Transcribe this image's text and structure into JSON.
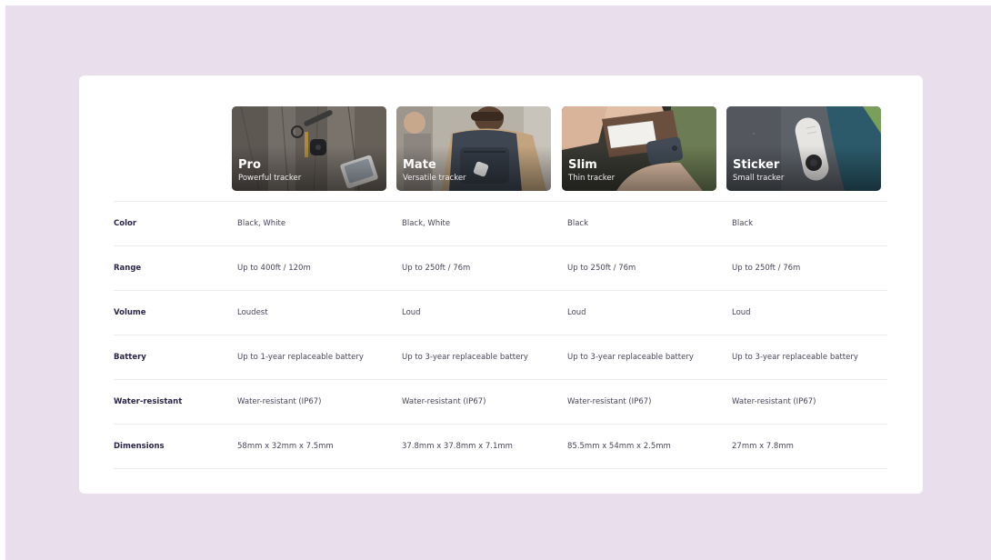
{
  "products": [
    {
      "name": "Pro",
      "tagline": "Powerful tracker",
      "image": "keys-on-wood-photo"
    },
    {
      "name": "Mate",
      "tagline": "Versatile tracker",
      "image": "backpack-photo"
    },
    {
      "name": "Slim",
      "tagline": "Thin tracker",
      "image": "wallet-photo"
    },
    {
      "name": "Sticker",
      "tagline": "Small tracker",
      "image": "sticker-on-fabric-photo"
    }
  ],
  "specs": [
    {
      "label": "Color",
      "values": [
        "Black, White",
        "Black, White",
        "Black",
        "Black"
      ]
    },
    {
      "label": "Range",
      "values": [
        "Up to 400ft / 120m",
        "Up to 250ft / 76m",
        "Up to 250ft / 76m",
        "Up to 250ft / 76m"
      ]
    },
    {
      "label": "Volume",
      "values": [
        "Loudest",
        "Loud",
        "Loud",
        "Loud"
      ]
    },
    {
      "label": "Battery",
      "values": [
        "Up to 1-year replaceable battery",
        "Up to 3-year replaceable battery",
        "Up to 3-year replaceable battery",
        "Up to 3-year replaceable battery"
      ]
    },
    {
      "label": "Water-resistant",
      "values": [
        "Water-resistant (IP67)",
        "Water-resistant (IP67)",
        "Water-resistant (IP67)",
        "Water-resistant (IP67)"
      ]
    },
    {
      "label": "Dimensions",
      "values": [
        "58mm x 32mm x 7.5mm",
        "37.8mm x 37.8mm x 7.1mm",
        "85.5mm x 54mm x 2.5mm",
        "27mm x 7.8mm"
      ]
    }
  ],
  "colors": {
    "page_background": "#e9dfec",
    "card_background": "#ffffff",
    "label_text": "#2c2547",
    "value_text": "#4a4458",
    "divider": "#eceaee"
  }
}
